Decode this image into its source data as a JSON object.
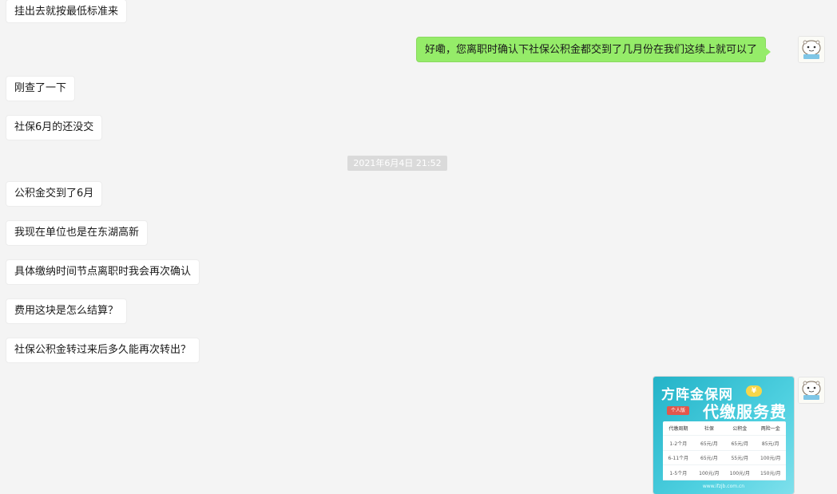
{
  "chat": {
    "messages": [
      {
        "side": "in",
        "text": "挂出去就按最低标准来"
      },
      {
        "side": "out",
        "text": "好嘞，您离职时确认下社保公积金都交到了几月份在我们这续上就可以了"
      },
      {
        "side": "in",
        "text": "刚查了一下"
      },
      {
        "side": "in",
        "text": "社保6月的还没交"
      },
      {
        "side": "in",
        "text": "公积金交到了6月"
      },
      {
        "side": "in",
        "text": "我现在单位也是在东湖高新"
      },
      {
        "side": "in",
        "text": "具体缴纳时间节点离职时我会再次确认"
      },
      {
        "side": "in",
        "text": "费用这块是怎么结算？"
      },
      {
        "side": "in",
        "text": "社保公积金转过来后多久能再次转出？"
      }
    ],
    "timestamp": "2021年6月4日 21:52",
    "promo_image": {
      "title": "方阵金保网",
      "coin": "¥",
      "tag": "个人版",
      "subtitle": "代缴服务费",
      "table": {
        "headers": [
          "代缴周期",
          "社保",
          "公积金",
          "两险一金"
        ],
        "rows": [
          [
            "1-2个月",
            "65元/月",
            "65元/月",
            "85元/月"
          ],
          [
            "6-11个月",
            "65元/月",
            "55元/月",
            "100元/月"
          ],
          [
            "1-5个月",
            "100元/月",
            "100元/月",
            "150元/月"
          ]
        ]
      },
      "url": "www.ifzjb.com.cn"
    },
    "colors": {
      "background": "#f4f4f4",
      "incoming_bubble": "#ffffff",
      "outgoing_bubble": "#95ec69",
      "timestamp_bg": "#dadada"
    }
  }
}
